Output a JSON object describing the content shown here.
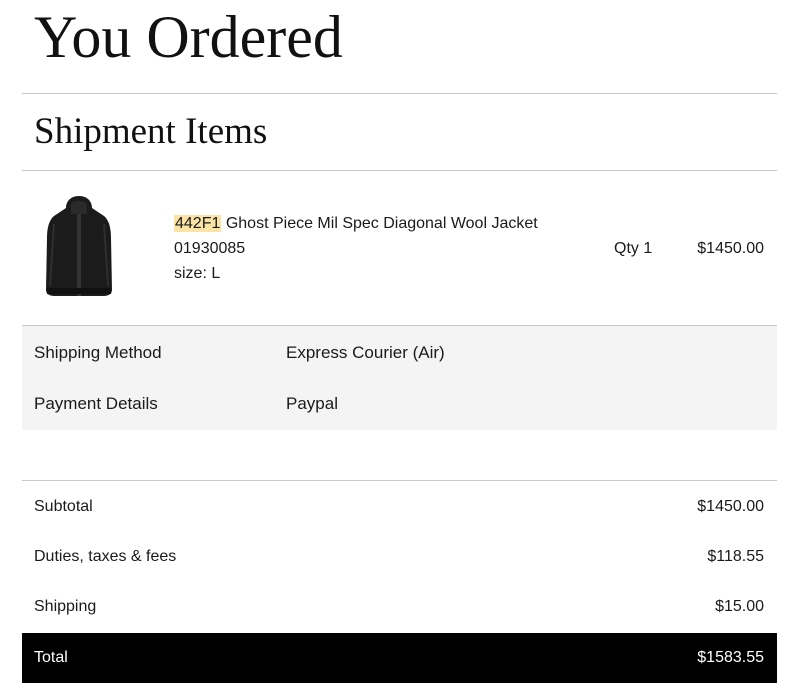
{
  "page": {
    "title": "You Ordered"
  },
  "shipment": {
    "heading": "Shipment Items",
    "items": [
      {
        "sku": "442F1",
        "name": "Ghost Piece Mil Spec Diagonal Wool Jacket",
        "code": "01930085",
        "size": "size: L",
        "qty": "Qty 1",
        "price": "$1450.00",
        "image_icon": "black-jacket-photo"
      }
    ]
  },
  "details": {
    "shipping_method_label": "Shipping Method",
    "shipping_method_value": "Express Courier (Air)",
    "payment_label": "Payment Details",
    "payment_value": "Paypal"
  },
  "summary": {
    "subtotal_label": "Subtotal",
    "subtotal_value": "$1450.00",
    "duties_label": "Duties, taxes & fees",
    "duties_value": "$118.55",
    "shipping_label": "Shipping",
    "shipping_value": "$15.00",
    "total_label": "Total",
    "total_value": "$1583.55"
  },
  "colors": {
    "highlight": "#fbe3a6",
    "total_bg": "#000000",
    "info_bg": "#f4f4f4"
  }
}
